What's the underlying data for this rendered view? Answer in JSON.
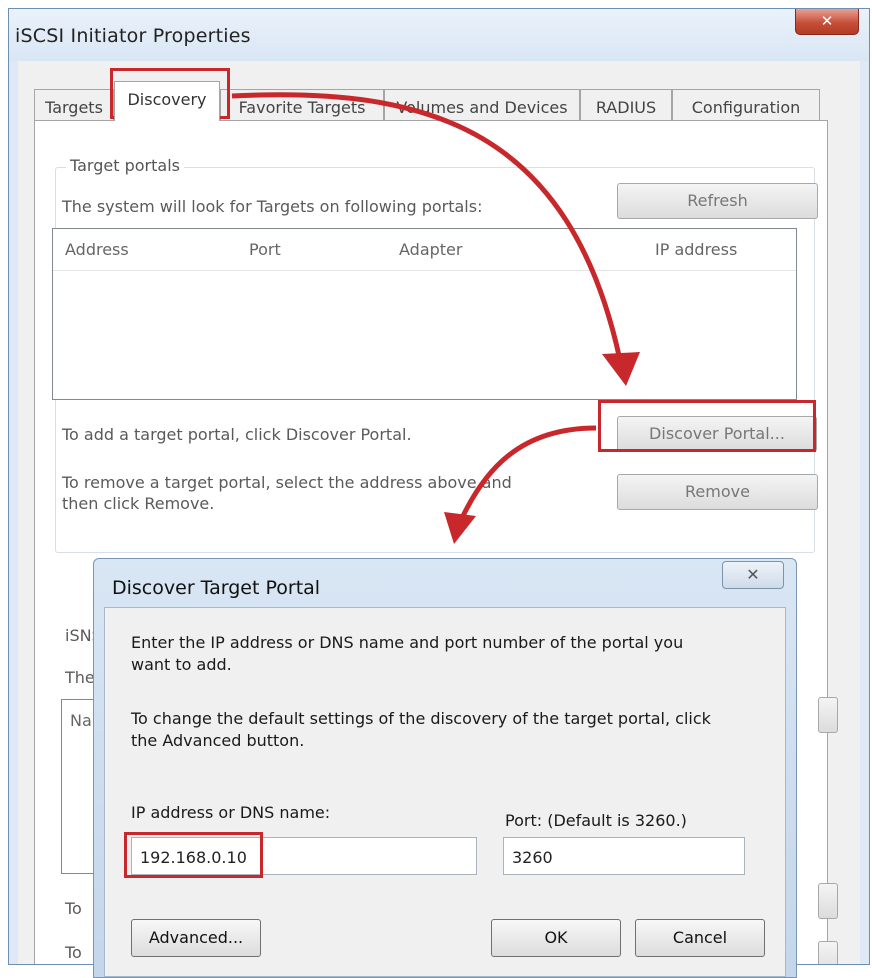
{
  "window": {
    "title": "iSCSI Initiator Properties",
    "close_glyph": "✕"
  },
  "tabs": [
    "Targets",
    "Discovery",
    "Favorite Targets",
    "Volumes and Devices",
    "RADIUS",
    "Configuration"
  ],
  "target_portals": {
    "group_title": "Target portals",
    "description": "The system will look for Targets on following portals:",
    "refresh_label": "Refresh",
    "columns": [
      "Address",
      "Port",
      "Adapter",
      "IP address"
    ],
    "add_hint": "To add a target portal, click Discover Portal.",
    "discover_label": "Discover Portal...",
    "remove_hint_line1": "To remove a target portal, select the address above and",
    "remove_hint_line2": "then click Remove.",
    "remove_label": "Remove"
  },
  "isns_partial": {
    "title_fragment": "iSNS",
    "text_fragment": "The",
    "column_fragment": "Na",
    "to_fragment_1": "To",
    "to_fragment_2": "To",
    "the_fragment": "the"
  },
  "dialog": {
    "title": "Discover Target Portal",
    "close_glyph": "✕",
    "intro_line1": "Enter the IP address or DNS name and port number of the portal you",
    "intro_line2": "want to add.",
    "advanced_hint_line1": "To change the default settings of the discovery of the target portal, click",
    "advanced_hint_line2": "the Advanced button.",
    "ip_label": "IP address or DNS name:",
    "ip_value": "192.168.0.10",
    "port_label": "Port: (Default is 3260.)",
    "port_value": "3260",
    "advanced_label": "Advanced...",
    "ok_label": "OK",
    "cancel_label": "Cancel"
  },
  "annotation_color": "#c8282b"
}
